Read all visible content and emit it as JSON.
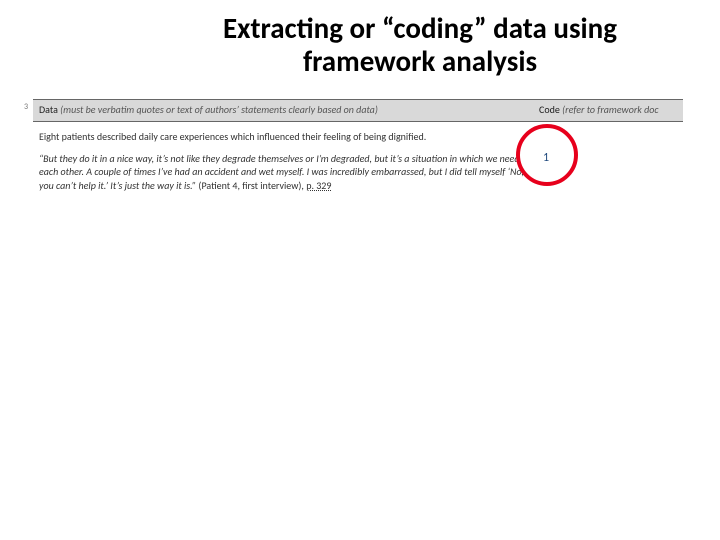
{
  "title": "Extracting or “coding” data using framework analysis",
  "tiny_mark": "3",
  "table": {
    "headers": {
      "data": {
        "label": "Data",
        "hint": " (must be verbatim quotes or text of authors’ statements clearly based on data)"
      },
      "code": {
        "label": "Code",
        "hint": " (refer to framework doc"
      }
    },
    "row": {
      "intro": "Eight patients described daily care experiences which influenced their feeling of being dignified.",
      "quote_body": "“But they do it in a nice way, it’s not like they degrade themselves or I’m degraded, but it’s a situation in which we need each other. A couple of times I’ve had an accident and wet myself. I was incredibly embarrassed, but I did tell myself ‘No, you can’t help it.’ It’s just the way it is.” ",
      "quote_source": "(Patient 4, first interview), ",
      "quote_page": "p. 329",
      "code_value": "1"
    }
  }
}
